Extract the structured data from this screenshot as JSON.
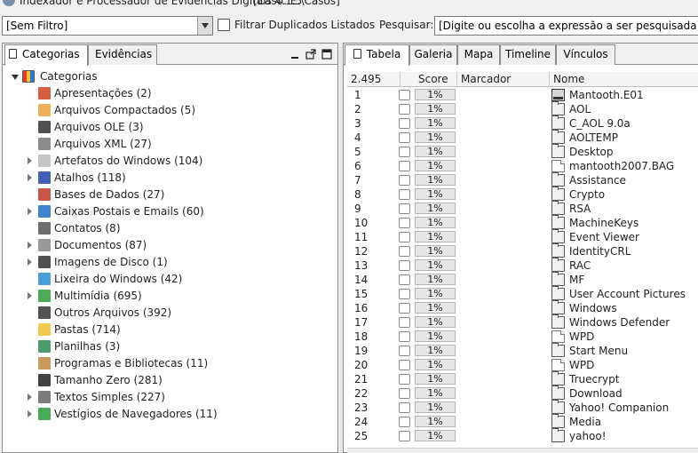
{
  "window": {
    "title": "Indexador e Processador de Evidências Digitais 4.1.5",
    "case_label": "[Caso: E:\\Casos]"
  },
  "toolbar": {
    "filter_value": "[Sem Filtro]",
    "dup_filter_label": "Filtrar Duplicados Listados",
    "dup_filter_checked": false,
    "search_label": "Pesquisar:",
    "search_value": "[Digite ou escolha a expressão a ser pesquisada]"
  },
  "left_panel": {
    "tabs": [
      {
        "label": "Categorias",
        "active": true
      },
      {
        "label": "Evidências",
        "active": false
      }
    ],
    "controls": [
      "minimize-icon",
      "undock-icon",
      "maximize-icon"
    ],
    "tree": {
      "root_label": "Categorias",
      "root_icon": "categories-icon",
      "items": [
        {
          "label": "Apresentações (2)",
          "expandable": false,
          "icon": "presentation-icon",
          "color": "#d04423"
        },
        {
          "label": "Arquivos Compactados (5)",
          "expandable": false,
          "icon": "archive-icon",
          "color": "#e8a33d"
        },
        {
          "label": "Arquivos OLE (3)",
          "expandable": false,
          "icon": "ole-icon",
          "color": "#333333"
        },
        {
          "label": "Arquivos XML (27)",
          "expandable": false,
          "icon": "xml-icon",
          "color": "#777777"
        },
        {
          "label": "Artefatos do Windows (104)",
          "expandable": true,
          "icon": "document-icon",
          "color": "#bbbbbb"
        },
        {
          "label": "Atalhos (118)",
          "expandable": true,
          "icon": "shortcut-icon",
          "color": "#2244aa"
        },
        {
          "label": "Bases de Dados (27)",
          "expandable": false,
          "icon": "database-icon",
          "color": "#c0392b"
        },
        {
          "label": "Caixas Postais e Emails (60)",
          "expandable": true,
          "icon": "outlook-icon",
          "color": "#1f6fc5"
        },
        {
          "label": "Contatos (8)",
          "expandable": false,
          "icon": "contacts-icon",
          "color": "#555555"
        },
        {
          "label": "Documentos (87)",
          "expandable": true,
          "icon": "documents-icon",
          "color": "#888888"
        },
        {
          "label": "Imagens de Disco (1)",
          "expandable": true,
          "icon": "disk-image-icon",
          "color": "#333333"
        },
        {
          "label": "Lixeira do Windows (42)",
          "expandable": false,
          "icon": "recycle-icon",
          "color": "#2a8fd0"
        },
        {
          "label": "Multimídia (695)",
          "expandable": true,
          "icon": "multimedia-icon",
          "color": "#2e9c3d"
        },
        {
          "label": "Outros Arquivos (392)",
          "expandable": false,
          "icon": "search-file-icon",
          "color": "#333333"
        },
        {
          "label": "Pastas (714)",
          "expandable": false,
          "icon": "folder-icon",
          "color": "#f2c12e"
        },
        {
          "label": "Planilhas (3)",
          "expandable": false,
          "icon": "spreadsheet-icon",
          "color": "#2e8b57"
        },
        {
          "label": "Programas e Bibliotecas (11)",
          "expandable": false,
          "icon": "programs-icon",
          "color": "#c08a3e"
        },
        {
          "label": "Tamanho Zero (281)",
          "expandable": false,
          "icon": "zero-size-icon",
          "color": "#222222"
        },
        {
          "label": "Textos Simples (227)",
          "expandable": true,
          "icon": "text-icon",
          "color": "#666666"
        },
        {
          "label": "Vestígios de Navegadores (11)",
          "expandable": true,
          "icon": "browser-icon",
          "color": "#2a9c3a"
        }
      ]
    }
  },
  "right_panel": {
    "tabs": [
      {
        "label": "Tabela",
        "active": true
      },
      {
        "label": "Galeria",
        "active": false
      },
      {
        "label": "Mapa",
        "active": false
      },
      {
        "label": "Timeline",
        "active": false
      },
      {
        "label": "Vínculos",
        "active": false
      }
    ],
    "table": {
      "count_header": "2.495",
      "columns": [
        "Score",
        "Marcador",
        "Nome"
      ],
      "rows": [
        {
          "num": "1",
          "score": "1%",
          "name": "Mantooth.E01",
          "icon": "disk-image-icon"
        },
        {
          "num": "2",
          "score": "1%",
          "name": "AOL",
          "icon": "folder-icon"
        },
        {
          "num": "3",
          "score": "1%",
          "name": "C_AOL 9.0a",
          "icon": "folder-icon"
        },
        {
          "num": "4",
          "score": "1%",
          "name": "AOLTEMP",
          "icon": "folder-icon"
        },
        {
          "num": "5",
          "score": "1%",
          "name": "Desktop",
          "icon": "folder-icon"
        },
        {
          "num": "6",
          "score": "1%",
          "name": "mantooth2007.BAG",
          "icon": "file-icon"
        },
        {
          "num": "7",
          "score": "1%",
          "name": "Assistance",
          "icon": "folder-icon"
        },
        {
          "num": "8",
          "score": "1%",
          "name": "Crypto",
          "icon": "folder-icon"
        },
        {
          "num": "9",
          "score": "1%",
          "name": "RSA",
          "icon": "folder-icon"
        },
        {
          "num": "10",
          "score": "1%",
          "name": "MachineKeys",
          "icon": "folder-icon"
        },
        {
          "num": "11",
          "score": "1%",
          "name": "Event Viewer",
          "icon": "folder-icon"
        },
        {
          "num": "12",
          "score": "1%",
          "name": "IdentityCRL",
          "icon": "folder-icon"
        },
        {
          "num": "13",
          "score": "1%",
          "name": "RAC",
          "icon": "folder-icon"
        },
        {
          "num": "14",
          "score": "1%",
          "name": "MF",
          "icon": "folder-icon"
        },
        {
          "num": "15",
          "score": "1%",
          "name": "User Account Pictures",
          "icon": "folder-icon"
        },
        {
          "num": "16",
          "score": "1%",
          "name": "Windows",
          "icon": "folder-icon"
        },
        {
          "num": "17",
          "score": "1%",
          "name": "Windows Defender",
          "icon": "folder-icon"
        },
        {
          "num": "18",
          "score": "1%",
          "name": "WPD",
          "icon": "file-icon"
        },
        {
          "num": "19",
          "score": "1%",
          "name": "Start Menu",
          "icon": "folder-icon"
        },
        {
          "num": "20",
          "score": "1%",
          "name": "WPD",
          "icon": "file-icon"
        },
        {
          "num": "21",
          "score": "1%",
          "name": "Truecrypt",
          "icon": "folder-icon"
        },
        {
          "num": "22",
          "score": "1%",
          "name": "Download",
          "icon": "folder-icon"
        },
        {
          "num": "23",
          "score": "1%",
          "name": "Yahoo! Companion",
          "icon": "folder-icon"
        },
        {
          "num": "24",
          "score": "1%",
          "name": "Media",
          "icon": "folder-icon"
        },
        {
          "num": "25",
          "score": "1%",
          "name": "yahoo!",
          "icon": "folder-icon"
        }
      ]
    }
  }
}
